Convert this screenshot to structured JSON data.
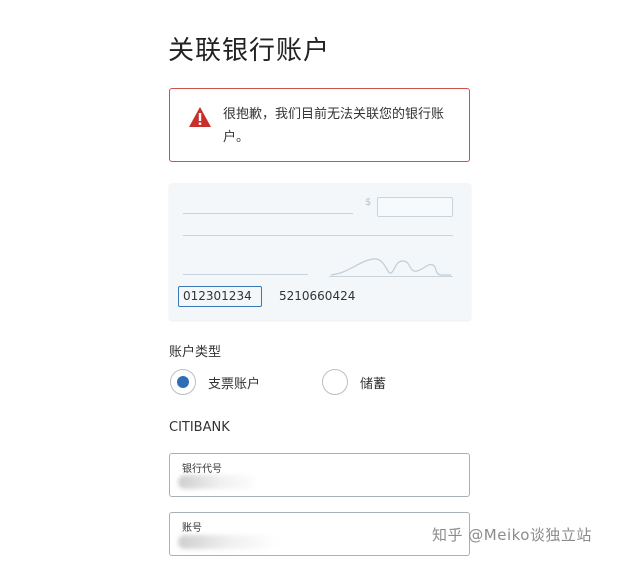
{
  "page": {
    "title": "关联银行账户"
  },
  "error": {
    "message": "很抱歉，我们目前无法关联您的银行账户。",
    "icon": "warning-triangle-icon",
    "color": "#c9524f"
  },
  "check_image": {
    "routing_number": "012301234",
    "account_number": "5210660424",
    "dollar_sign": "$",
    "highlight_color": "#3a78b8"
  },
  "account_type": {
    "label": "账户类型",
    "options": [
      {
        "label": "支票账户",
        "selected": true
      },
      {
        "label": "储蓄",
        "selected": false
      }
    ],
    "accent_color": "#2f6db5"
  },
  "bank": {
    "name": "CITIBANK"
  },
  "fields": {
    "routing": {
      "label": "银行代号"
    },
    "account": {
      "label": "账号"
    }
  },
  "watermark": {
    "text": "知乎 @Meiko谈独立站"
  }
}
